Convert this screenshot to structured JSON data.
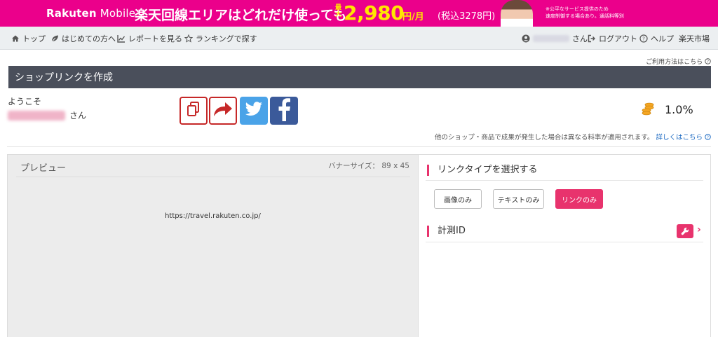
{
  "banner": {
    "brand_main": "Rakuten",
    "brand_sub": " Mobile",
    "headline": "楽天回線エリアはどれだけ使っても",
    "max_label": "最大",
    "price": "2,980",
    "unit": "円/月",
    "tax": "(税込3278円)",
    "note_line1": "※公平なサービス提供のため",
    "note_line2": "速度制御する場合あり。通話料等別",
    "brand_color": "#eb008b"
  },
  "nav": {
    "items": [
      {
        "label": "トップ",
        "icon": "home-icon"
      },
      {
        "label": "はじめての方へ",
        "icon": "leaf-icon"
      },
      {
        "label": "レポートを見る",
        "icon": "chart-icon"
      },
      {
        "label": "ランキングで探す",
        "icon": "star-icon"
      }
    ],
    "user_suffix": "さん",
    "logout": "ログアウト",
    "help": "ヘルプ",
    "market": "楽天市場"
  },
  "help_link": "ご利用方法はこちら",
  "header": {
    "title": "ショップリンクを作成"
  },
  "welcome": {
    "greeting": "ようこそ",
    "suffix": "さん"
  },
  "rate": {
    "value": "1.0%"
  },
  "rate_note": {
    "text": "他のショップ・商品で成果が発生した場合は異なる料率が適用されます。",
    "link": "詳しくはこちら"
  },
  "preview": {
    "title": "プレビュー",
    "banner_size": "バナーサイズ： 89 x 45",
    "url": "https://travel.rakuten.co.jp/"
  },
  "link_type": {
    "title": "リンクタイプを選択する",
    "options": [
      "画像のみ",
      "テキストのみ",
      "リンクのみ"
    ],
    "selected": "リンクのみ"
  },
  "tracking": {
    "title": "計測ID"
  },
  "colors": {
    "accent": "#e8336d",
    "header_bg": "#4a4f5b",
    "twitter": "#4aa3e8",
    "facebook": "#3b5a9a"
  }
}
